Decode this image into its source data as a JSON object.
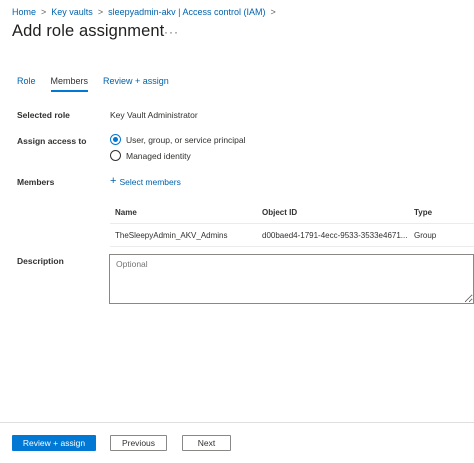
{
  "breadcrumb": {
    "items": [
      "Home",
      "Key vaults",
      "sleepyadmin-akv | Access control (IAM)"
    ],
    "separator": ">"
  },
  "page": {
    "title": "Add role assignment",
    "more_label": "···"
  },
  "tabs": [
    {
      "label": "Role",
      "active": false
    },
    {
      "label": "Members",
      "active": true
    },
    {
      "label": "Review + assign",
      "active": false
    }
  ],
  "form": {
    "selected_role_label": "Selected role",
    "selected_role_value": "Key Vault Administrator",
    "assign_access_label": "Assign access to",
    "assign_options": [
      {
        "label": "User, group, or service principal",
        "checked": true
      },
      {
        "label": "Managed identity",
        "checked": false
      }
    ],
    "members_label": "Members",
    "select_members_label": "Select members",
    "plus_icon": "+",
    "description_label": "Description",
    "description_placeholder": "Optional"
  },
  "members_table": {
    "columns": [
      "Name",
      "Object ID",
      "Type"
    ],
    "rows": [
      [
        "TheSleepyAdmin_AKV_Admins",
        "d00baed4-1791-4ecc-9533-3533e4671...",
        "Group"
      ]
    ]
  },
  "footer": {
    "review_assign_label": "Review + assign",
    "previous_label": "Previous",
    "next_label": "Next"
  },
  "colors": {
    "accent": "#0078d4",
    "link": "#0062ad",
    "text": "#323130"
  }
}
